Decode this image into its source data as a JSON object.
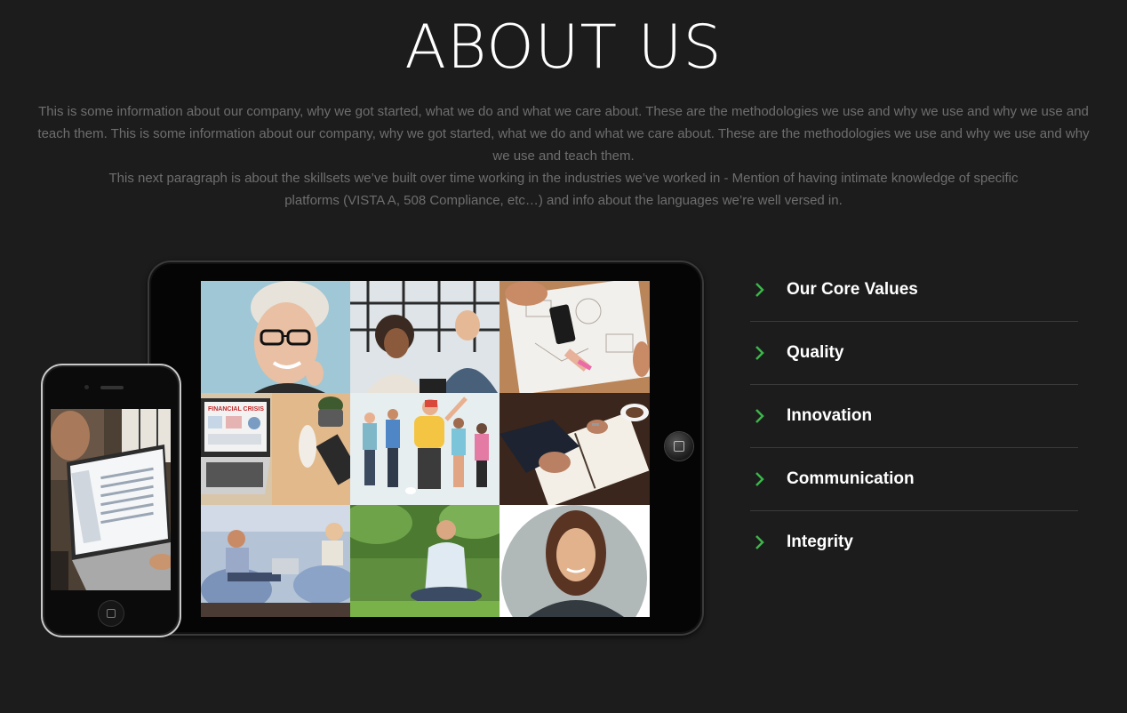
{
  "section": {
    "title": "ABOUT US",
    "paragraph_1": "This is some information about our company, why we got started, what we do and what we care about. These are the methodologies we use and why we use and why we use and teach them. This is some information about our company, why we got started, what we do and what we care about. These are the methodologies we use and why we use and why we use and teach them.",
    "paragraph_2": "This next paragraph is about the skillsets we’ve built over time working in the industries we’ve worked in - Mention of having intimate knowledge of specific platforms (VISTA A, 508 Compliance, etc…) and info about the languages we’re well versed in."
  },
  "tablet_tiles": [
    "woman-with-glasses-photo",
    "office-meeting-photo",
    "planning-desk-photo",
    "laptop-financial-crisis-photo",
    "people-illustration",
    "planner-notebook-photo",
    "couple-with-laptop-photo",
    "man-on-grass-photo",
    "smiling-woman-photo"
  ],
  "laptop_screen_text": "FINANCIAL CRISIS",
  "values": {
    "accent_color": "#3cb64a",
    "items": [
      {
        "label": "Our Core Values",
        "icon": "chevron-right-icon"
      },
      {
        "label": "Quality",
        "icon": "chevron-right-icon"
      },
      {
        "label": "Innovation",
        "icon": "chevron-right-icon"
      },
      {
        "label": "Communication",
        "icon": "chevron-right-icon"
      },
      {
        "label": "Integrity",
        "icon": "chevron-right-icon"
      }
    ]
  }
}
